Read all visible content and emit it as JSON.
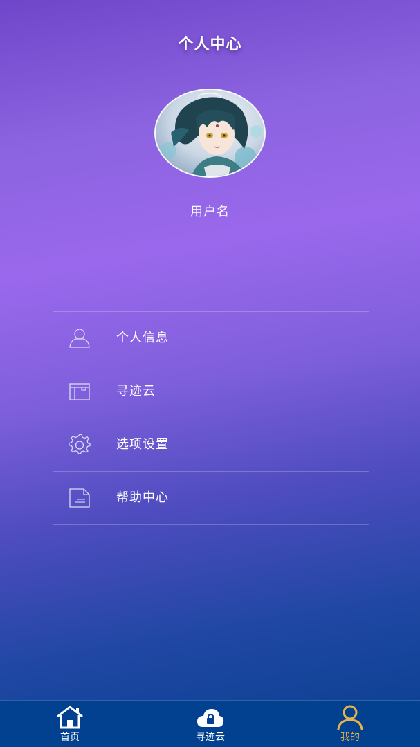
{
  "header": {
    "title": "个人中心"
  },
  "profile": {
    "username": "用户名"
  },
  "menu": {
    "items": [
      {
        "label": "个人信息",
        "icon": "user-icon"
      },
      {
        "label": "寻迹云",
        "icon": "box-icon"
      },
      {
        "label": "选项设置",
        "icon": "gear-icon"
      },
      {
        "label": "帮助中心",
        "icon": "document-icon"
      }
    ]
  },
  "tabbar": {
    "items": [
      {
        "label": "首页",
        "icon": "home-icon",
        "active": false
      },
      {
        "label": "寻迹云",
        "icon": "cloud-lock-icon",
        "active": false
      },
      {
        "label": "我的",
        "icon": "person-icon",
        "active": true
      }
    ]
  },
  "colors": {
    "active_tab": "#e8b44a",
    "tabbar_bg": "#02418f"
  }
}
